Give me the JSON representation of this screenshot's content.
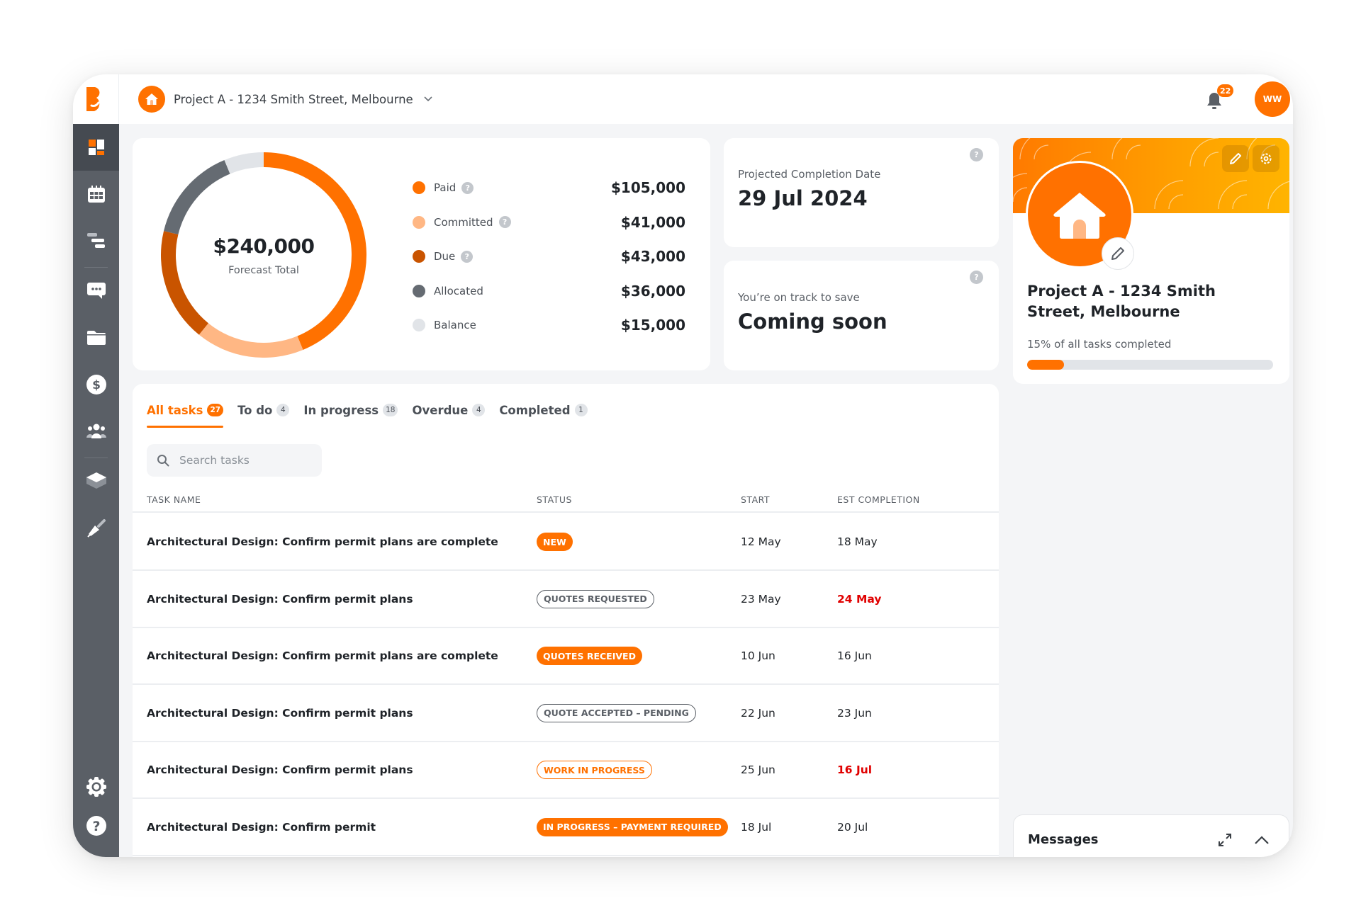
{
  "header": {
    "project_name": "Project A - 1234 Smith Street, Melbourne",
    "notifications_count": "22",
    "user_initials": "WW"
  },
  "sidebar": {
    "items": [
      {
        "name": "dashboard",
        "icon": "dashboard-icon",
        "active": true
      },
      {
        "name": "calendar",
        "icon": "calendar-icon",
        "active": false
      },
      {
        "name": "timeline",
        "icon": "gantt-icon",
        "active": false
      },
      {
        "name": "messages",
        "icon": "chat-icon",
        "active": false
      },
      {
        "name": "documents",
        "icon": "folder-icon",
        "active": false
      },
      {
        "name": "finance",
        "icon": "dollar-icon",
        "active": false
      },
      {
        "name": "team",
        "icon": "team-icon",
        "active": false
      },
      {
        "name": "layers",
        "icon": "layers-icon",
        "active": false
      },
      {
        "name": "design",
        "icon": "paintbrush-icon",
        "active": false
      }
    ],
    "bottom": [
      {
        "name": "settings",
        "icon": "gear-icon"
      },
      {
        "name": "help",
        "icon": "help-icon"
      }
    ]
  },
  "budget": {
    "total": "$240,000",
    "total_label": "Forecast Total",
    "help_glyph": "?"
  },
  "chart_data": {
    "type": "pie",
    "title": "Forecast Total",
    "total": 240000,
    "categories": [
      "Paid",
      "Committed",
      "Due",
      "Allocated",
      "Balance"
    ],
    "values": [
      105000,
      41000,
      43000,
      36000,
      15000
    ],
    "display_values": [
      "$105,000",
      "$41,000",
      "$43,000",
      "$36,000",
      "$15,000"
    ],
    "colors": [
      "#ff7100",
      "#ffb784",
      "#c95400",
      "#656b72",
      "#e1e4e8"
    ],
    "help": [
      true,
      true,
      true,
      false,
      false
    ],
    "legend": "right",
    "donut": true
  },
  "completion": {
    "label": "Projected Completion Date",
    "value": "29 Jul 2024"
  },
  "savings": {
    "label": "You’re on track to save",
    "value": "Coming soon"
  },
  "project_card": {
    "title": "Project A - 1234 Smith Street, Melbourne",
    "progress_label": "15% of all tasks completed",
    "progress_percent": 15
  },
  "tasks": {
    "tabs": [
      {
        "label": "All tasks",
        "count": "27",
        "active": true
      },
      {
        "label": "To do",
        "count": "4",
        "active": false
      },
      {
        "label": "In progress",
        "count": "18",
        "active": false
      },
      {
        "label": "Overdue",
        "count": "4",
        "active": false
      },
      {
        "label": "Completed",
        "count": "1",
        "active": false
      }
    ],
    "search_placeholder": "Search tasks",
    "columns": [
      "TASK NAME",
      "STATUS",
      "START",
      "EST COMPLETION"
    ],
    "rows": [
      {
        "name": "Architectural Design: Confirm permit plans are complete",
        "status": "NEW",
        "status_style": "solid",
        "start": "12 May",
        "end": "18 May",
        "late": false
      },
      {
        "name": "Architectural Design: Confirm permit plans",
        "status": "QUOTES REQUESTED",
        "status_style": "outline-gray",
        "start": "23 May",
        "end": "24 May",
        "late": true
      },
      {
        "name": "Architectural Design: Confirm permit plans are complete",
        "status": "QUOTES RECEIVED",
        "status_style": "solid",
        "start": "10 Jun",
        "end": "16 Jun",
        "late": false
      },
      {
        "name": "Architectural Design: Confirm permit plans",
        "status": "QUOTE ACCEPTED – PENDING",
        "status_style": "outline-gray",
        "start": "22 Jun",
        "end": "23 Jun",
        "late": false
      },
      {
        "name": "Architectural Design: Confirm permit plans",
        "status": "WORK IN PROGRESS",
        "status_style": "outline-orange",
        "start": "25 Jun",
        "end": "16 Jul",
        "late": true
      },
      {
        "name": "Architectural Design: Confirm permit",
        "status": "IN PROGRESS – PAYMENT REQUIRED",
        "status_style": "solid",
        "start": "18 Jul",
        "end": "20 Jul",
        "late": false
      }
    ]
  },
  "messages": {
    "title": "Messages"
  },
  "colors": {
    "accent": "#ff7100",
    "sidebar": "#5a5f66",
    "late": "#e00000"
  }
}
